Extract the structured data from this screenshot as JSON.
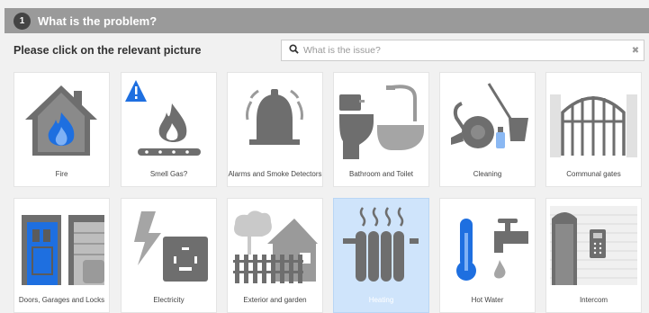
{
  "header": {
    "step": "1",
    "title": "What is the problem?"
  },
  "instruction": "Please click on the relevant picture",
  "search": {
    "placeholder": "What is the issue?",
    "value": ""
  },
  "tiles": [
    {
      "label": "Fire",
      "icon": "fire-house-icon"
    },
    {
      "label": "Smell Gas?",
      "icon": "gas-flame-icon"
    },
    {
      "label": "Alarms and Smoke Detectors",
      "icon": "alarm-bell-icon"
    },
    {
      "label": "Bathroom and Toilet",
      "icon": "bathroom-icon"
    },
    {
      "label": "Cleaning",
      "icon": "cleaning-icon"
    },
    {
      "label": "Communal gates",
      "icon": "gates-icon"
    },
    {
      "label": "Doors, Garages and Locks",
      "icon": "door-garage-icon"
    },
    {
      "label": "Electricity",
      "icon": "electric-socket-icon"
    },
    {
      "label": "Exterior and garden",
      "icon": "garden-icon"
    },
    {
      "label": "Heating",
      "icon": "radiator-icon",
      "selected": true
    },
    {
      "label": "Hot Water",
      "icon": "hot-water-icon"
    },
    {
      "label": "Intercom",
      "icon": "intercom-icon"
    }
  ],
  "colors": {
    "header": "#9a9a9a",
    "icon": "#707070",
    "accent_blue": "#1e6fe0",
    "selected_tile": "#cfe4fb"
  }
}
